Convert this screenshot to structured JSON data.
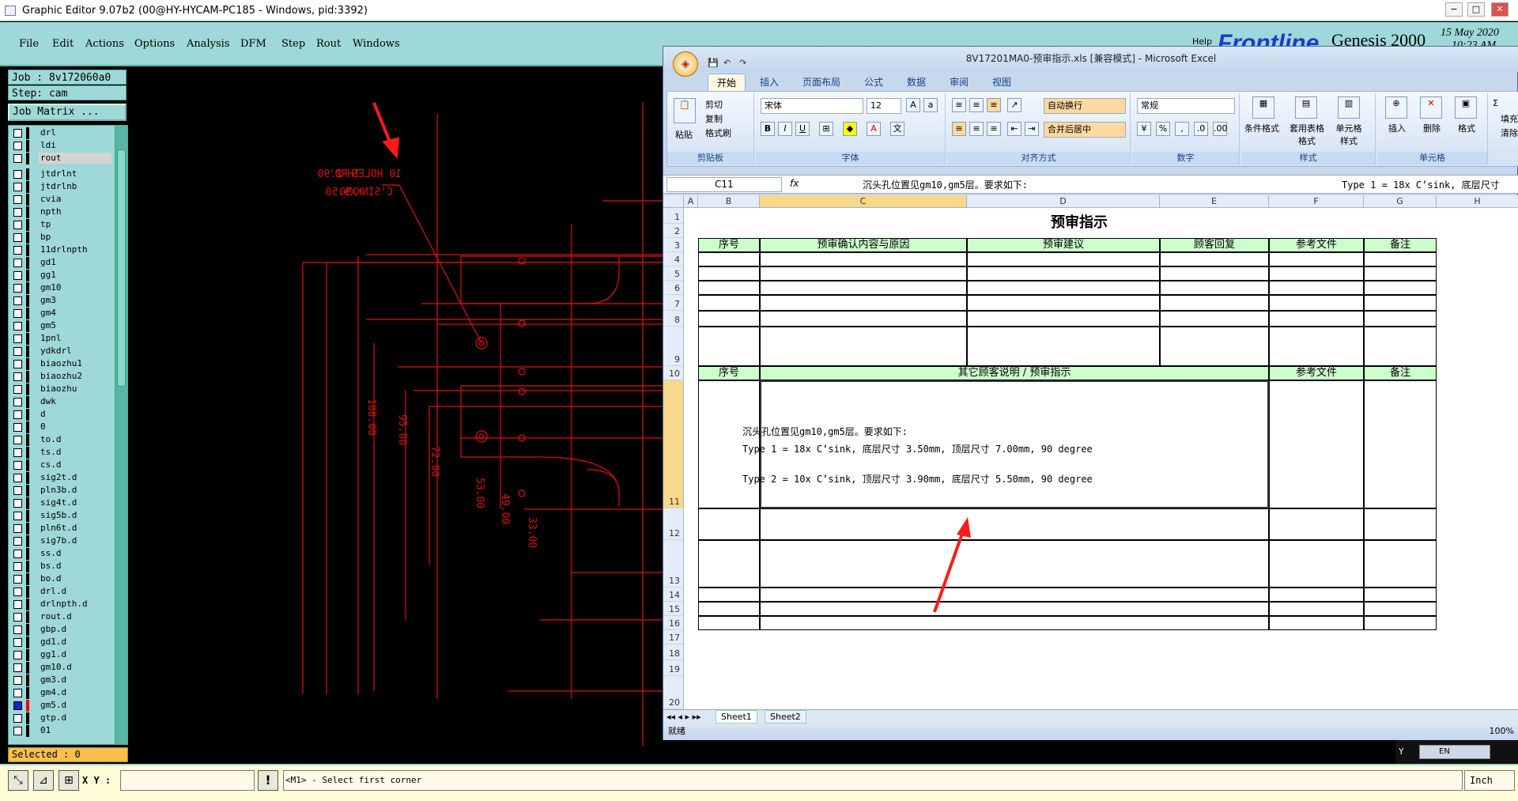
{
  "ge": {
    "title": "Graphic Editor 9.07b2 (00@HY-HYCAM-PC185 - Windows, pid:3392)",
    "menu": [
      "File",
      "Edit",
      "Actions",
      "Options",
      "Analysis",
      "DFM",
      "Step",
      "Rout",
      "Windows"
    ],
    "job": "Job : 8v172060a0",
    "step": "Step: cam",
    "job_matrix_label": "Job Matrix ...",
    "brand": {
      "help": "Help",
      "logo": "Frontline",
      "product": "Genesis 2000",
      "date": "15 May 2020",
      "time": "10:23 AM"
    },
    "layers_top": [
      "drl",
      "ldi",
      "rout"
    ],
    "layers": [
      "jtdrlnt",
      "jtdrlnb",
      "cvia",
      "npth",
      "tp",
      "bp",
      "11drlnpth",
      "gd1",
      "gg1",
      "gm10",
      "gm3",
      "gm4",
      "gm5",
      "1pnl",
      "ydkdrl",
      "biaozhu1",
      "biaozhu2",
      "biaozhu",
      "dwk",
      "d",
      "0",
      "to.d",
      "ts.d",
      "cs.d",
      "sig2t.d",
      "pln3b.d",
      "sig4t.d",
      "sig5b.d",
      "pln6t.d",
      "sig7b.d",
      "ss.d",
      "bs.d",
      "bo.d",
      "drl.d",
      "drlnpth.d",
      "rout.d",
      "gbp.d",
      "gd1.d",
      "gg1.d",
      "gm10.d",
      "gm3.d",
      "gm4.d",
      "gm5.d",
      "gtp.d",
      "01"
    ],
    "selected": "Selected : 0",
    "xy_label": "X Y :",
    "prompt": "<M1> - Select first corner",
    "unit": "Inch",
    "y_label": "Y",
    "lang": "EN",
    "canvas_text": {
      "holes": "10 HOLES",
      "size1": "2.90",
      "thru": "THRO'",
      "csink": "C'SINK",
      "size2": "5.50",
      "x": "X",
      "angle": "90",
      "dims": [
        "108.00",
        "95.00",
        "72.00",
        "53.00",
        "49.00",
        "33.00"
      ]
    }
  },
  "excel": {
    "title": "8V17201MA0-预审指示.xls  [兼容模式] - Microsoft Excel",
    "tabs": [
      "开始",
      "插入",
      "页面布局",
      "公式",
      "数据",
      "审阅",
      "视图"
    ],
    "ribbon": {
      "clipboard": {
        "group": "剪贴板",
        "paste": "粘贴",
        "cut": "剪切",
        "copy": "复制",
        "painter": "格式刷"
      },
      "font": {
        "group": "字体",
        "name": "宋体",
        "size": "12"
      },
      "align": {
        "group": "对齐方式",
        "wrap": "自动换行",
        "merge": "合并后居中"
      },
      "number": {
        "group": "数字",
        "format": "常规"
      },
      "styles": {
        "group": "样式",
        "cond": "条件格式",
        "table": "套用表格格式",
        "cell": "单元格样式"
      },
      "cells": {
        "group": "单元格",
        "insert": "插入",
        "delete": "删除",
        "format": "格式"
      },
      "edit": {
        "sum": "Σ",
        "fill": "填充",
        "clear": "清除"
      }
    },
    "namebox": "C11",
    "fx": "fx",
    "formula": "沉头孔位置见gm10,gm5层。要求如下:",
    "formula_right": "Type 1 = 18x C’sink, 底层尺寸",
    "columns": [
      "A",
      "B",
      "C",
      "D",
      "E",
      "F",
      "G",
      "H"
    ],
    "rows": [
      "1",
      "2",
      "3",
      "4",
      "5",
      "6",
      "7",
      "8",
      "9",
      "10",
      "11",
      "12",
      "13",
      "14",
      "15",
      "16",
      "17",
      "18",
      "19",
      "20"
    ],
    "sheet_title": "预审指示",
    "header1": [
      "序号",
      "预审确认内容与原因",
      "预审建议",
      "顾客回复",
      "参考文件",
      "备注"
    ],
    "header2": [
      "序号",
      "其它顾客说明 / 预审指示",
      "参考文件",
      "备注"
    ],
    "note_lines": [
      "沉头孔位置见gm10,gm5层。要求如下:",
      "Type 1 = 18x C’sink, 底层尺寸 3.50mm, 顶层尺寸 7.00mm, 90 degree",
      "Type 2 = 10x C’sink, 顶层尺寸 3.90mm, 底层尺寸 5.50mm, 90 degree"
    ],
    "sheets": [
      "Sheet1",
      "Sheet2"
    ],
    "status": "就绪",
    "zoom": "100%"
  },
  "colors": {
    "teal": "#9fd8d8",
    "cad_red": "#e01010",
    "arrow": "#ff1a1a",
    "header_green": "#ccffcc"
  }
}
